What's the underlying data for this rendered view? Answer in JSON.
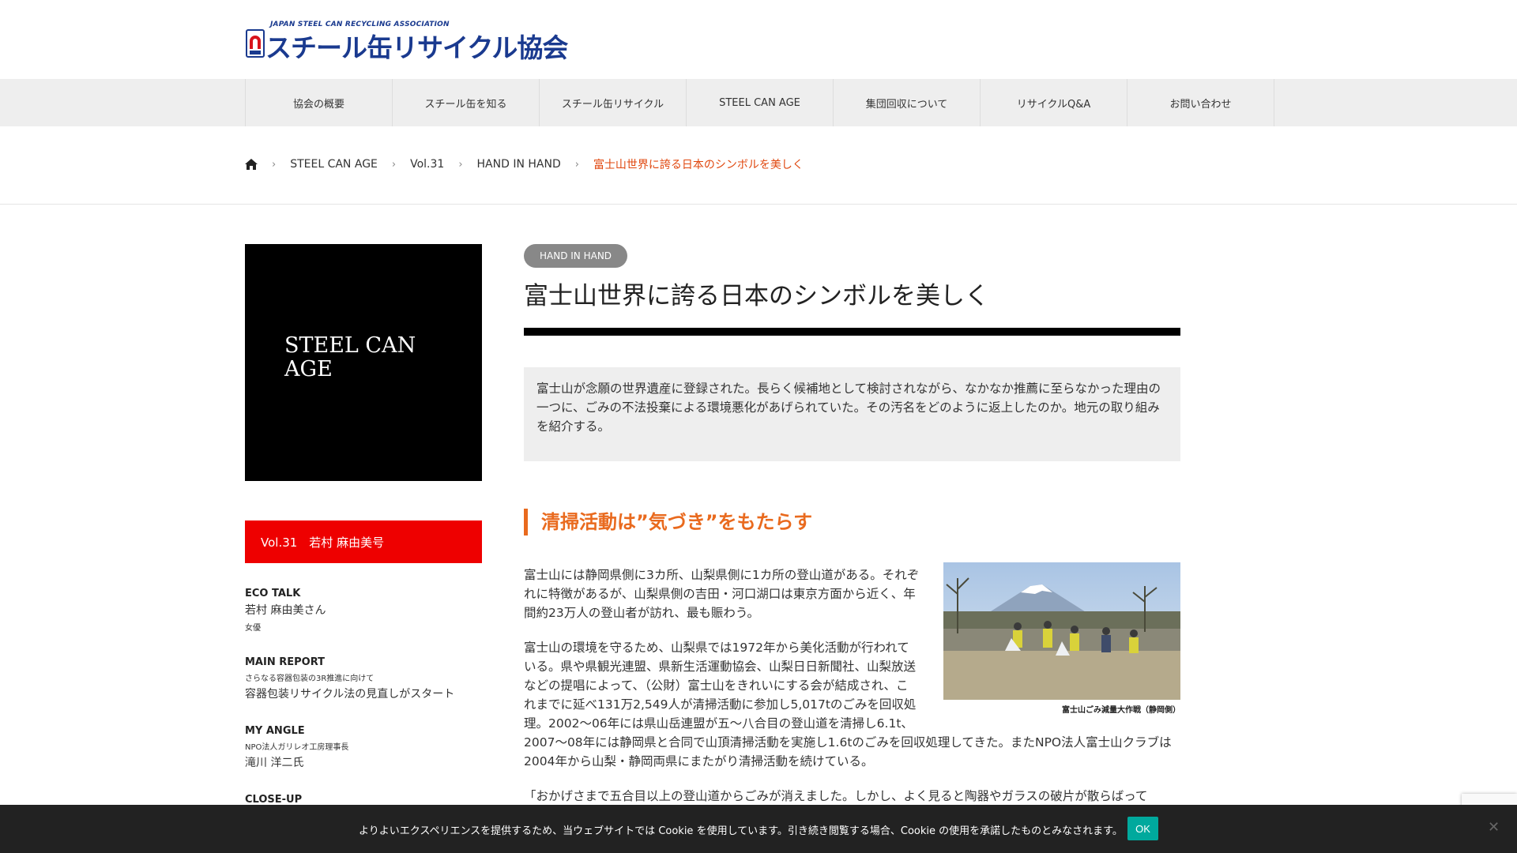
{
  "header": {
    "logo_en": "JAPAN STEEL CAN RECYCLING ASSOCIATION",
    "logo_jp": "スチール缶リサイクル協会"
  },
  "nav": {
    "items": [
      "協会の概要",
      "スチール缶を知る",
      "スチール缶リサイクル",
      "STEEL CAN AGE",
      "集団回収について",
      "リサイクルQ&A",
      "お問い合わせ"
    ]
  },
  "breadcrumb": {
    "items": [
      "STEEL CAN AGE",
      "Vol.31",
      "HAND IN HAND"
    ],
    "current": "富士山世界に誇る日本のシンボルを美しく",
    "home_icon": "home-icon"
  },
  "sidebar": {
    "hero_title": "STEEL CAN AGE",
    "vol_label": "Vol.31　若村 麻由美号",
    "sections": [
      {
        "heading": "ECO TALK",
        "main": "若村 麻由美さん",
        "sub": "女優"
      },
      {
        "heading": "MAIN REPORT",
        "sub": "さらなる容器包装の3R推進に向けて",
        "main": "容器包装リサイクル法の見直しがスタート"
      },
      {
        "heading": "MY ANGLE",
        "sub": "NPO法人ガリレオ工房理事長",
        "main": "滝川 洋二氏"
      },
      {
        "heading": "CLOSE-UP"
      }
    ]
  },
  "article": {
    "tag": "HAND IN HAND",
    "title": "富士山世界に誇る日本のシンボルを美しく",
    "lead": "富士山が念願の世界遺産に登録された。長らく候補地として検討されながら、なかなか推薦に至らなかった理由の一つに、ごみの不法投棄による環境悪化があげられていた。その汚名をどのように返上したのか。地元の取り組みを紹介する。",
    "subhead": "清掃活動は”気づき”をもたらす",
    "paragraphs": [
      "富士山には静岡県側に3カ所、山梨県側に1カ所の登山道がある。それぞれに特徴があるが、山梨県側の吉田・河口湖口は東京方面から近く、年間約23万人の登山者が訪れ、最も賑わう。",
      "富士山の環境を守るため、山梨県では1972年から美化活動が行われている。県や県観光連盟、県新生活運動協会、山梨日日新聞社、山梨放送などの提唱によって、（公財）富士山をきれいにする会が結成され、これまでに延べ131万2,549人が清掃活動に参加し5,017tのごみを回収処理。2002～06年には県山岳連盟が五～八合目の登山道を清掃し6.1t、2007～08年には静岡県と合同で山頂清掃活動を実施し1.6tのごみを回収処理してきた。またNPO法人富士山クラブは2004年から山梨・静岡両県にまたがり清掃活動を続けている。",
      "「おかげさまで五合目以上の登山道からごみが消えました。しかし、よく見ると陶器やガラスの破片が散らばって"
    ],
    "figure_caption": "富士山ごみ減量大作戦（静岡側）"
  },
  "cookie": {
    "message": "よりよいエクスペリエンスを提供するため、当ウェブサイトでは Cookie を使用しています。引き続き閲覧する場合、Cookie の使用を承諾したものとみなされます。",
    "ok_label": "OK",
    "close_icon": "close-icon"
  }
}
